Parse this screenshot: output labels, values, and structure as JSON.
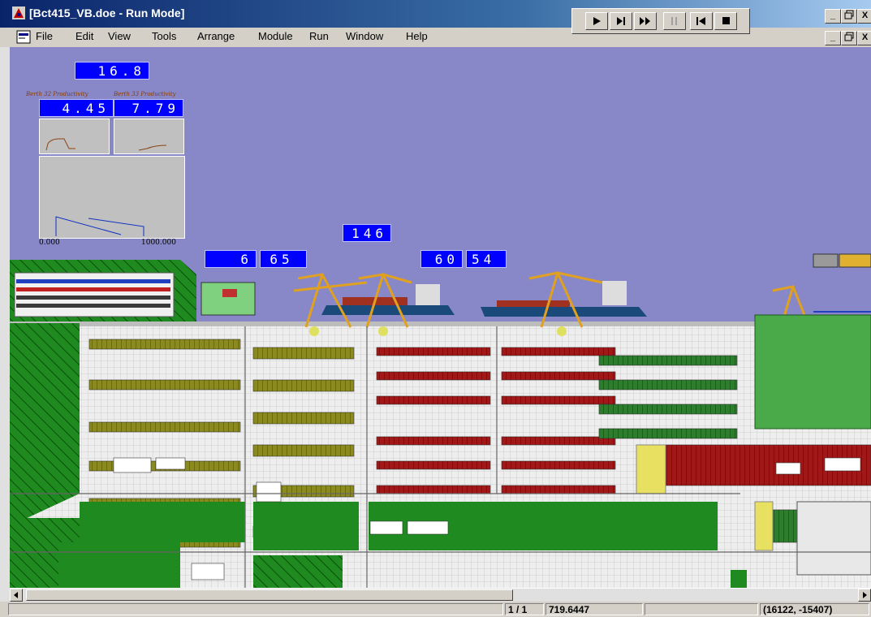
{
  "window": {
    "title": "[Bct415_VB.doe - Run Mode]",
    "min_glyph": "_",
    "restore_glyph": "🗗",
    "close_glyph": "X"
  },
  "menu": [
    "File",
    "Edit",
    "View",
    "Tools",
    "Arrange",
    "Module",
    "Run",
    "Window",
    "Help"
  ],
  "run_controls": [
    {
      "name": "go-icon",
      "glyph": "▶"
    },
    {
      "name": "step-icon",
      "glyph": "▶|"
    },
    {
      "name": "fast-forward-icon",
      "glyph": "▶▶"
    },
    {
      "name": "pause-icon",
      "glyph": "||"
    },
    {
      "name": "start-icon",
      "glyph": "|◀"
    },
    {
      "name": "stop-icon",
      "glyph": "■"
    }
  ],
  "dashboard": {
    "clock_value": "16.8",
    "berth32_label": "Berth 32 Productivity",
    "berth33_label": "Berth 33 Productivity",
    "berth32_value": "4.45",
    "berth33_value": "7.79",
    "plot_xmin": "0.000",
    "plot_xmax": "1000.000",
    "counter_top": "146",
    "counter_a": "6",
    "counter_b": "65",
    "counter_c": "60",
    "counter_d": "54"
  },
  "status": {
    "page": "1 / 1",
    "zoom": "719.6447",
    "coords": "(16122, -15407)"
  },
  "colors": {
    "sky": "#8888c8",
    "display_blue": "#0000ff",
    "grass": "#1f8a1f",
    "yard": "#e8e8e8",
    "container_red": "#a01818",
    "container_olive": "#8a8a20",
    "crane": "#e0a020"
  }
}
